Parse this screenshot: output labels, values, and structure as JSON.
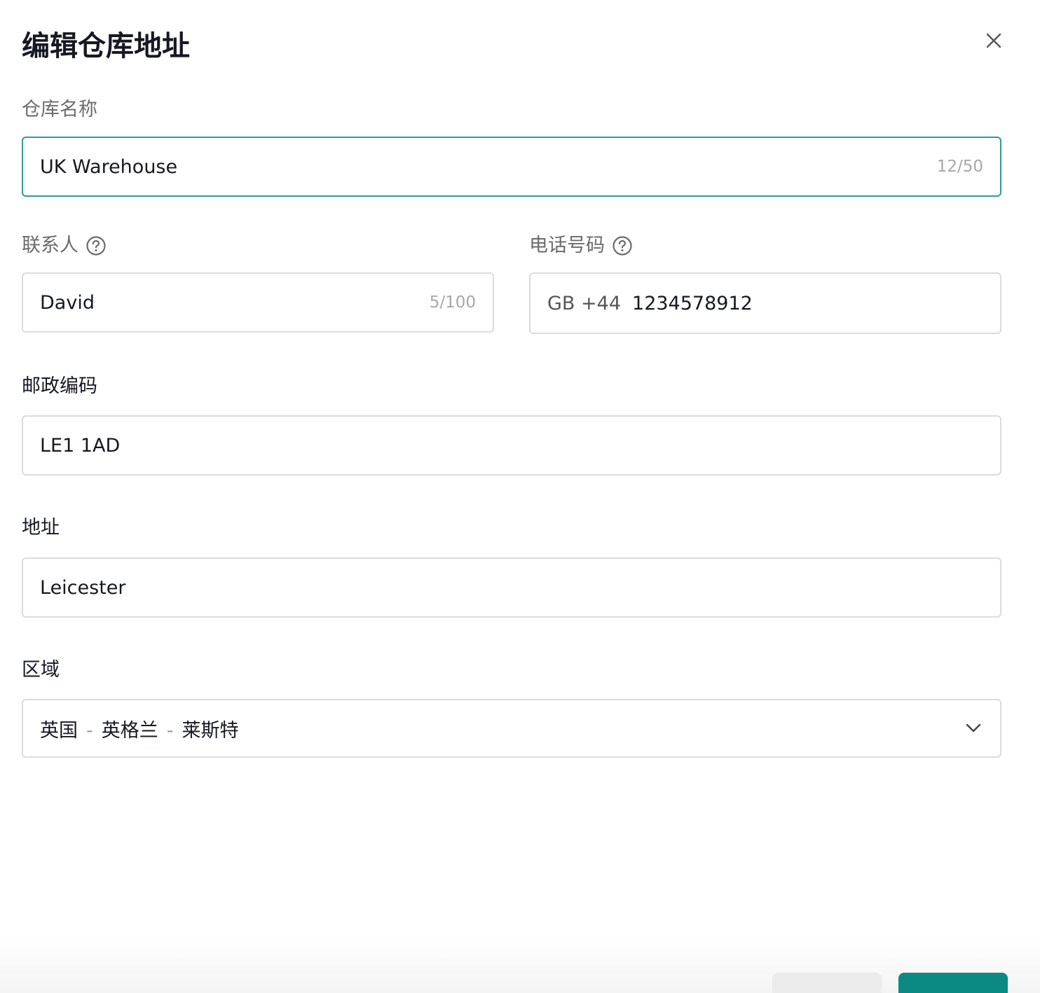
{
  "dialog": {
    "title": "编辑仓库地址",
    "close_icon": "close-icon"
  },
  "warehouse_name": {
    "label": "仓库名称",
    "value": "UK Warehouse",
    "counter": "12/50"
  },
  "contact": {
    "label": "联系人",
    "help_icon": "question-circle-icon",
    "value": "David",
    "counter": "5/100"
  },
  "phone": {
    "label": "电话号码",
    "help_icon": "question-circle-icon",
    "country_code": "GB +44",
    "value": "1234578912"
  },
  "postal_code": {
    "label": "邮政编码",
    "value": "LE1 1AD"
  },
  "address": {
    "label": "地址",
    "value": "Leicester"
  },
  "region": {
    "label": "区域",
    "country": "英国",
    "state": "英格兰",
    "city": "莱斯特",
    "separator": "-",
    "chevron_icon": "chevron-down-icon"
  },
  "colors": {
    "focus_border": "#2e9d92",
    "primary_button": "#0a8a82",
    "secondary_button": "#ebebeb"
  }
}
